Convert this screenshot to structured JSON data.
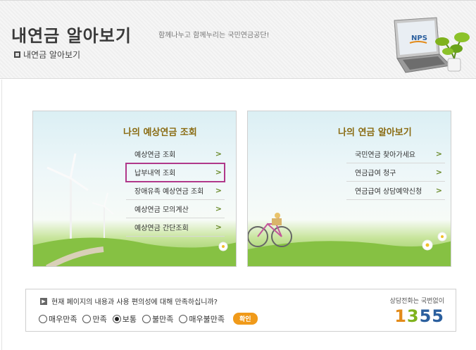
{
  "header": {
    "title": "내연금 알아보기",
    "subtitle": "함께나누고 함께누리는 국민연금공단!",
    "breadcrumb": "내연금 알아보기",
    "laptop_logo": "NPS"
  },
  "left_panel": {
    "title": "나의 예상연금 조회",
    "items": [
      {
        "label": "예상연금 조회"
      },
      {
        "label": "납부내역 조회",
        "highlighted": true
      },
      {
        "label": "장애유족 예상연금 조회"
      },
      {
        "label": "예상연금 모의계산"
      },
      {
        "label": "예상연금 간단조회"
      }
    ]
  },
  "right_panel": {
    "title": "나의 연금 알아보기",
    "items": [
      {
        "label": "국민연금 찾아가세요"
      },
      {
        "label": "연금급여 청구"
      },
      {
        "label": "연금급여 상담예약신청"
      }
    ]
  },
  "survey": {
    "question": "현재 페이지의 내용과 사용 편의성에 대해 만족하십니까?",
    "options": [
      "매우만족",
      "만족",
      "보통",
      "불만족",
      "매우불만족"
    ],
    "selected": "보통",
    "confirm_label": "확인"
  },
  "callcenter": {
    "label": "상담전화는 국번없이",
    "digits": [
      "1",
      "3",
      "5",
      "5"
    ]
  },
  "colors": {
    "title_gold": "#8a6b12",
    "highlight": "#b0388a",
    "confirm": "#f09a1a"
  }
}
